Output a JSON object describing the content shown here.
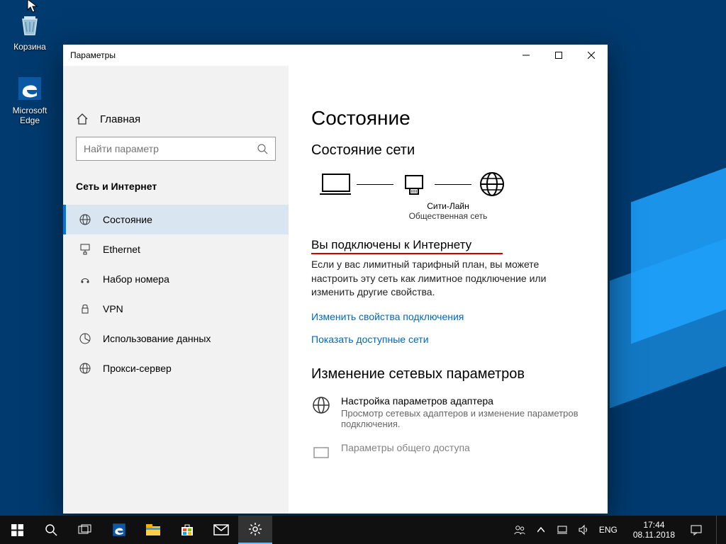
{
  "desktop": {
    "icons": [
      {
        "name": "recycle-bin",
        "label": "Корзина"
      },
      {
        "name": "edge",
        "label": "Microsoft Edge"
      }
    ]
  },
  "window": {
    "title": "Параметры",
    "sidebar": {
      "home": "Главная",
      "search_placeholder": "Найти параметр",
      "section": "Сеть и Интернет",
      "items": [
        {
          "label": "Состояние",
          "active": true
        },
        {
          "label": "Ethernet",
          "active": false
        },
        {
          "label": "Набор номера",
          "active": false
        },
        {
          "label": "VPN",
          "active": false
        },
        {
          "label": "Использование данных",
          "active": false
        },
        {
          "label": "Прокси-сервер",
          "active": false
        }
      ]
    },
    "main": {
      "title": "Состояние",
      "subtitle": "Состояние сети",
      "net_name": "Сити-Лайн",
      "net_type": "Общественная сеть",
      "connected_title": "Вы подключены к Интернету",
      "paragraph": "Если у вас лимитный тарифный план, вы можете настроить эту сеть как лимитное подключение или изменить другие свойства.",
      "link1": "Изменить свойства подключения",
      "link2": "Показать доступные сети",
      "section2_title": "Изменение сетевых параметров",
      "adapter_title": "Настройка параметров адаптера",
      "adapter_desc": "Просмотр сетевых адаптеров и изменение параметров подключения.",
      "sharing_title": "Параметры общего доступа"
    }
  },
  "taskbar": {
    "lang": "ENG",
    "time": "17:44",
    "date": "08.11.2018"
  }
}
